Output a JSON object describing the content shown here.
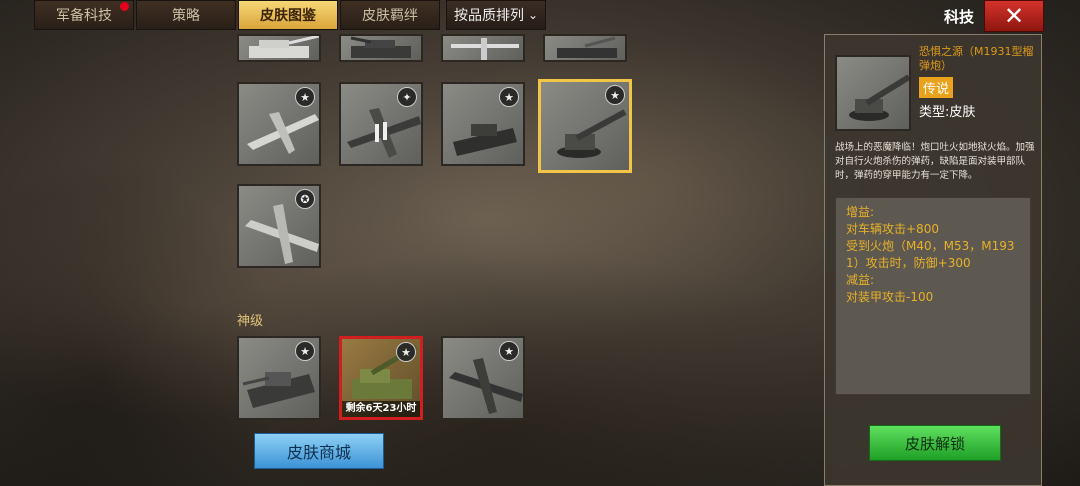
{
  "tabs": [
    {
      "label": "军备科技",
      "active": false,
      "has_dot": true
    },
    {
      "label": "策略",
      "active": false,
      "has_dot": false
    },
    {
      "label": "皮肤图鉴",
      "active": true,
      "has_dot": false
    },
    {
      "label": "皮肤羁绊",
      "active": false,
      "has_dot": false
    }
  ],
  "sort": {
    "label": "按品质排列",
    "icon": "chevron-down-icon"
  },
  "header": {
    "title": "科技",
    "close_icon": "close-icon",
    "close_color": "#c1271f"
  },
  "section_god": {
    "label": "神级"
  },
  "god_cards": [
    {
      "name": "tank",
      "timer": ""
    },
    {
      "name": "artillery",
      "timer": "剩余6天23小时"
    },
    {
      "name": "plane",
      "timer": ""
    }
  ],
  "shop_button": {
    "label": "皮肤商城"
  },
  "detail": {
    "name": "恐惧之源（M1931型榴弹炮）",
    "rarity": "传说",
    "rarity_color": "#e8a21b",
    "type": "类型:皮肤",
    "description": "战场上的恶魔降临！炮口吐火如地狱火焰。加强对自行火炮杀伤的弹药，缺陷是面对装甲部队时，弹药的穿甲能力有一定下降。",
    "bonus_lines": [
      "增益:",
      "对车辆攻击+800",
      "受到火炮（M40，M53，M193",
      "1）攻击时，防御+300",
      "减益:",
      "对装甲攻击-100"
    ],
    "unlock_label": "皮肤解锁"
  },
  "colors": {
    "accent": "#f2c546",
    "legend_text": "#e09a1a",
    "bonus_text": "#e8b12a"
  }
}
